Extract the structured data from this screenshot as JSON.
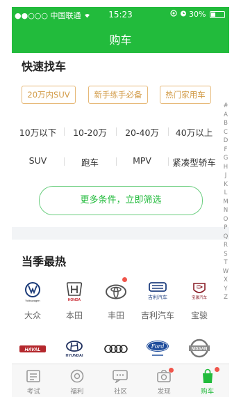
{
  "status_bar": {
    "carrier": "●●○○○ 中国联通",
    "time": "15:23",
    "battery": "30%",
    "battery_level": 0.3
  },
  "nav": {
    "title": "购车"
  },
  "quick_find": {
    "title": "快速找车",
    "tags": [
      "20万内SUV",
      "新手练手必备",
      "热门家用车"
    ],
    "price_ranges": [
      "10万以下",
      "10-20万",
      "20-40万",
      "40万以上"
    ],
    "car_types": [
      "SUV",
      "跑车",
      "MPV",
      "紧凑型轿车"
    ],
    "more_button": "更多条件，立即筛选"
  },
  "alphabet_index": [
    "#",
    "A",
    "B",
    "C",
    "D",
    "F",
    "G",
    "H",
    "J",
    "K",
    "L",
    "M",
    "N",
    "O",
    "P",
    "Q",
    "R",
    "S",
    "T",
    "W",
    "X",
    "Y",
    "Z"
  ],
  "hot_season": {
    "title": "当季最热",
    "brands_row1": [
      {
        "name": "大众",
        "icon": "volkswagen-logo",
        "logo_text": "Volkswagen"
      },
      {
        "name": "本田",
        "icon": "honda-logo",
        "logo_text": "HONDA"
      },
      {
        "name": "丰田",
        "icon": "toyota-logo"
      },
      {
        "name": "吉利汽车",
        "icon": "geely-logo",
        "logo_text": "吉利汽车"
      },
      {
        "name": "宝骏",
        "icon": "baojun-logo",
        "logo_text": "宝骏汽车"
      }
    ],
    "brands_row2": [
      {
        "icon": "haval-logo",
        "logo_text": "HAVAL"
      },
      {
        "icon": "hyundai-logo",
        "logo_text": "HYUNDAI"
      },
      {
        "icon": "audi-logo"
      },
      {
        "icon": "ford-logo",
        "logo_text": "Ford"
      },
      {
        "icon": "nissan-logo",
        "logo_text": "NISSAN"
      }
    ]
  },
  "tab_bar": {
    "tabs": [
      {
        "label": "考试",
        "icon": "exam-icon"
      },
      {
        "label": "福利",
        "icon": "welfare-icon"
      },
      {
        "label": "社区",
        "icon": "community-icon"
      },
      {
        "label": "发现",
        "icon": "discover-icon"
      },
      {
        "label": "购车",
        "icon": "buy-car-icon"
      }
    ]
  },
  "colors": {
    "brand": "#22bb3c",
    "tag": "#d29b47",
    "badge": "#f0554b"
  }
}
